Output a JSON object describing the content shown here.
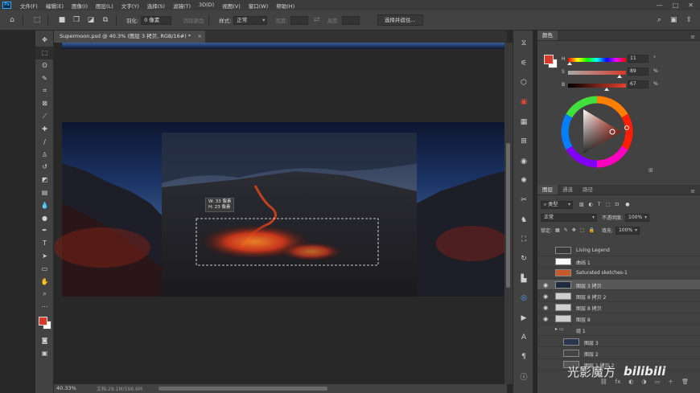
{
  "menubar": {
    "app_icon_label": "Ps",
    "items": [
      "文件(F)",
      "编辑(E)",
      "图像(I)",
      "图层(L)",
      "文字(Y)",
      "选择(S)",
      "滤镜(T)",
      "3D(D)",
      "视图(V)",
      "窗口(W)",
      "帮助(H)"
    ],
    "minimize": "—",
    "maximize": "□",
    "close": "✕"
  },
  "options_bar": {
    "feather_label": "羽化:",
    "feather_value": "0 像素",
    "antialias_label": "消除锯齿",
    "style_label": "样式:",
    "style_value": "正常",
    "width_label": "宽度:",
    "height_label": "高度:",
    "select_mask_button": "选择并遮住..."
  },
  "document": {
    "tab_title": "Supermoon.psd @ 40.3% (图层 3 拷贝, RGB/16#) *",
    "tab_close": "×",
    "zoom": "40.33%",
    "doc_info": "文档:29.1M/598.6M",
    "selection_readout": {
      "width": "W: 33 像素",
      "height": "H: 23 像素"
    }
  },
  "color_panel": {
    "tab": "颜色",
    "h": {
      "label": "H",
      "value": "11",
      "unit": "°",
      "fraction": 0.03
    },
    "s": {
      "label": "S",
      "value": "89",
      "unit": "%",
      "fraction": 0.89
    },
    "b": {
      "label": "B",
      "value": "67",
      "unit": "%",
      "fraction": 0.67
    },
    "foreground": "#d63a2a",
    "background": "#ffffff"
  },
  "layers_panel": {
    "tabs": [
      "图层",
      "通道",
      "路径"
    ],
    "filter_kind": "类型",
    "blend_mode": "正常",
    "opacity_label": "不透明度:",
    "opacity_value": "100%",
    "lock_label": "锁定:",
    "fill_label": "填充:",
    "fill_value": "100%",
    "layers": [
      {
        "name": "Living Legend",
        "visible": false,
        "thumb": "#3a3a3a",
        "indent": 0
      },
      {
        "name": "曲线 1",
        "visible": false,
        "thumb": "#ffffff",
        "indent": 0
      },
      {
        "name": "Saturated sketches-1",
        "visible": false,
        "thumb": "#c85a2a",
        "indent": 0
      },
      {
        "name": "图层 3 拷贝",
        "visible": true,
        "thumb": "#1e2a3e",
        "indent": 0,
        "selected": true
      },
      {
        "name": "图层 8 拷贝 2",
        "visible": true,
        "thumb": "#cfcfcf",
        "indent": 0
      },
      {
        "name": "图层 8 拷贝",
        "visible": true,
        "thumb": "#cfcfcf",
        "indent": 0
      },
      {
        "name": "图层 8",
        "visible": true,
        "thumb": "#cfcfcf",
        "indent": 0
      },
      {
        "name": "组 1",
        "visible": false,
        "thumb": "folder",
        "indent": 0
      },
      {
        "name": "图层 3",
        "visible": false,
        "thumb": "#2a3550",
        "indent": 1
      },
      {
        "name": "图层 2",
        "visible": false,
        "thumb": "#444444",
        "indent": 1
      },
      {
        "name": "图层 1 拷贝 2",
        "visible": false,
        "thumb": "#555555",
        "indent": 1
      }
    ],
    "footer": [
      "⛓",
      "fx",
      "◐",
      "◑",
      "▭",
      "＋",
      "🗑"
    ]
  },
  "watermark": {
    "text": "光影魔方",
    "logo": "bilibili"
  }
}
